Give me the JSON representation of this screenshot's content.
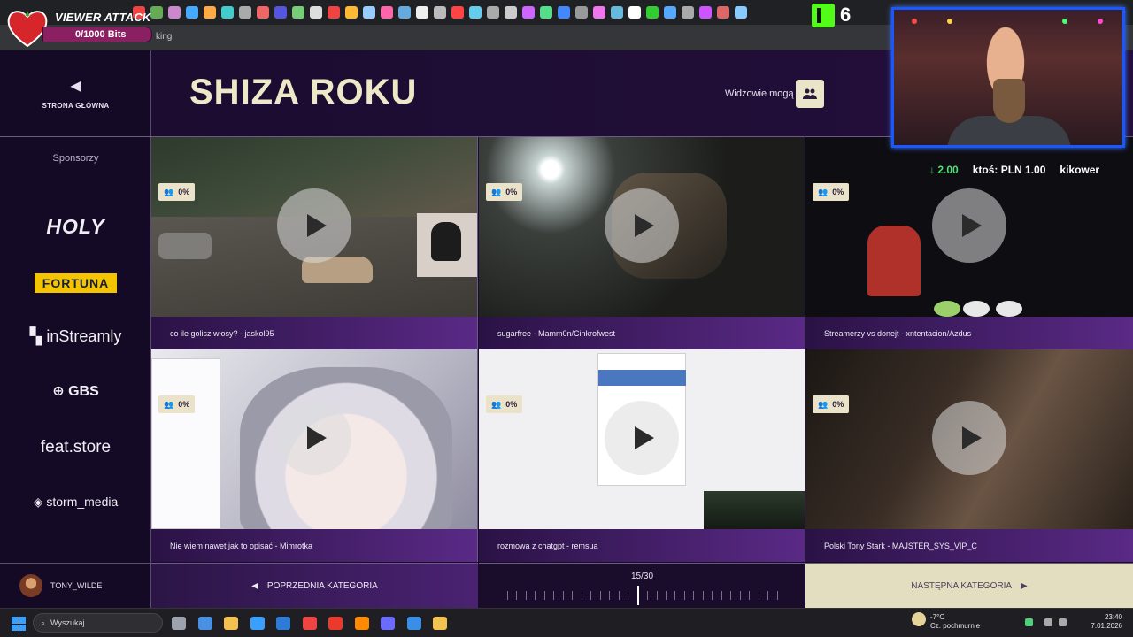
{
  "overlay": {
    "viewer_attack_title": "VIEWER ATTACK",
    "viewer_attack_progress": "0/1000 Bits",
    "kick_count": "6",
    "tips": [
      "↓ 2.00",
      "ktoś: PLN 1.00",
      "kikower"
    ]
  },
  "browser": {
    "address_fragment": "king"
  },
  "sidebar": {
    "home_label": "STRONA GŁÓWNA",
    "sponsors_label": "Sponsorzy",
    "sponsors": [
      "HOLY",
      "FORTUNA",
      "inStreamly",
      "GBS",
      "feat.store",
      "storm_media"
    ],
    "user_name": "TONY_WILDE"
  },
  "header": {
    "title": "SHIZA ROKU",
    "watch_label": "Widzowie mogą"
  },
  "cards": [
    {
      "percent": "0%",
      "caption": "co ile golisz włosy? - jaskol95"
    },
    {
      "percent": "0%",
      "caption": "sugarfree - Mamm0n/Cinkrofwest"
    },
    {
      "percent": "0%",
      "caption": "Streamerzy vs donejt - xntentacion/Azdus"
    },
    {
      "percent": "0%",
      "caption": "Nie wiem nawet jak to opisać - Mimrotka"
    },
    {
      "percent": "0%",
      "caption": "rozmowa z chatgpt - remsua"
    },
    {
      "percent": "0%",
      "caption": "Polski Tony Stark - MAJSTER_SYS_VIP_C"
    }
  ],
  "footer": {
    "prev_label": "POPRZEDNIA KATEGORIA",
    "page_indicator": "15/30",
    "page_current": 15,
    "page_total": 30,
    "next_label": "NASTĘPNA KATEGORIA"
  },
  "taskbar": {
    "search_placeholder": "Wyszukaj",
    "weather_temp": "-7°C",
    "weather_desc": "Cz. pochmurnie",
    "time": "23:40",
    "date": "7.01.2026"
  },
  "colors": {
    "page_bg": "#180b2b",
    "accent_cream": "#eae3c9",
    "caption_gradient_end": "#5a2a86",
    "webcam_border": "#1a58ff"
  }
}
